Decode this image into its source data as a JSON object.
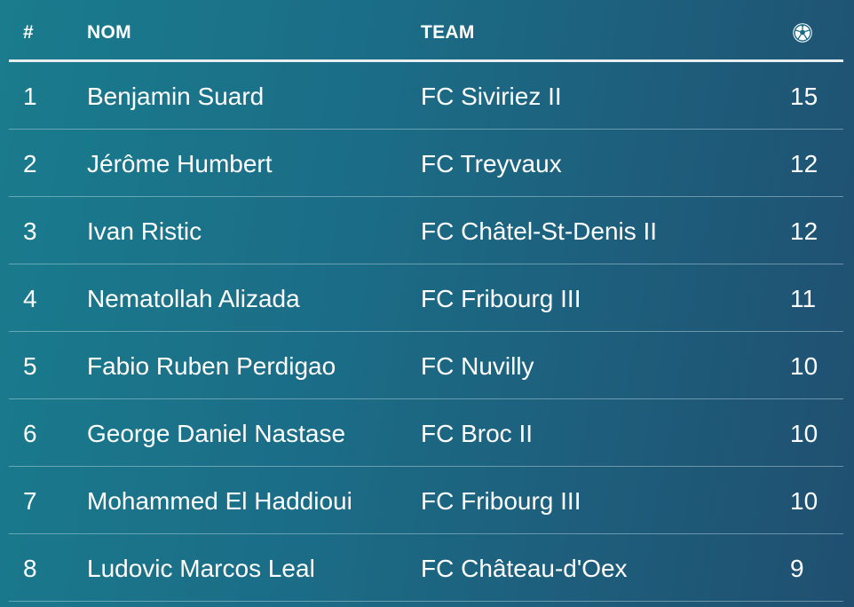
{
  "header": {
    "rank_label": "#",
    "name_label": "NOM",
    "team_label": "TEAM",
    "goals_icon": "soccer-ball-icon"
  },
  "rows": [
    {
      "rank": "1",
      "name": "Benjamin Suard",
      "team": "FC Siviriez II",
      "goals": "15"
    },
    {
      "rank": "2",
      "name": "Jérôme Humbert",
      "team": "FC Treyvaux",
      "goals": "12"
    },
    {
      "rank": "3",
      "name": "Ivan Ristic",
      "team": "FC Châtel-St-Denis II",
      "goals": "12"
    },
    {
      "rank": "4",
      "name": "Nematollah Alizada",
      "team": "FC Fribourg III",
      "goals": "11"
    },
    {
      "rank": "5",
      "name": "Fabio Ruben Perdigao",
      "team": "FC Nuvilly",
      "goals": "10"
    },
    {
      "rank": "6",
      "name": "George Daniel Nastase",
      "team": "FC Broc II",
      "goals": "10"
    },
    {
      "rank": "7",
      "name": "Mohammed El Haddioui",
      "team": "FC Fribourg III",
      "goals": "10"
    },
    {
      "rank": "8",
      "name": "Ludovic Marcos Leal",
      "team": "FC Château-d'Oex",
      "goals": "9"
    }
  ],
  "colors": {
    "background_left": "#1a7c8d",
    "background_right": "#204f70",
    "text": "#ffffff",
    "header_rule": "#e8eef0"
  }
}
